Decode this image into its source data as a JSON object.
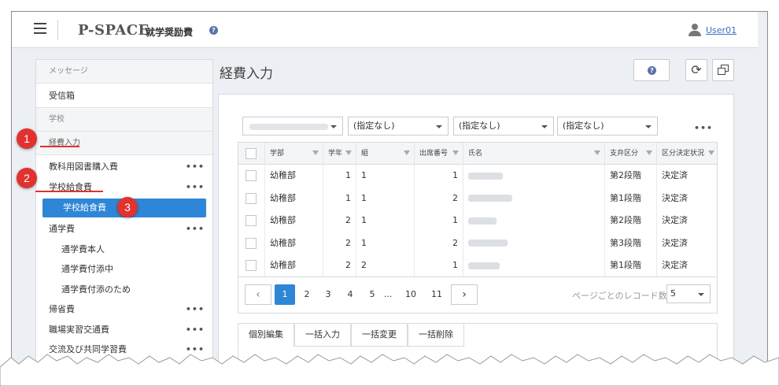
{
  "header": {
    "brand": "P-SPACE",
    "brand_sub": "就学奨励費",
    "user": "User01"
  },
  "sidebar": {
    "sections": [
      {
        "label": "メッセージ"
      },
      {
        "label": "学校"
      }
    ],
    "inbox": "受信箱",
    "expense_input": "経費入力",
    "items": [
      {
        "label": "教科用図書購入費",
        "more": "•••"
      },
      {
        "label": "学校給食費",
        "more": "•••"
      },
      {
        "label": "学校給食費",
        "active": true
      },
      {
        "label": "通学費",
        "more": "•••"
      },
      {
        "label": "通学費本人"
      },
      {
        "label": "通学費付添中"
      },
      {
        "label": "通学費付添のため"
      },
      {
        "label": "帰省費",
        "more": "•••"
      },
      {
        "label": "職場実習交通費",
        "more": "•••"
      },
      {
        "label": "交流及び共同学習費",
        "more": "•••"
      }
    ]
  },
  "callouts": [
    "1",
    "2",
    "3"
  ],
  "main": {
    "title": "経費入力",
    "refresh_glyph": "⟳",
    "filters": [
      "(指定なし)",
      "(指定なし)",
      "(指定なし)"
    ],
    "more": "•••",
    "grid": {
      "columns": [
        "学部",
        "学年",
        "組",
        "出席番号",
        "氏名",
        "支弁区分",
        "区分決定状況"
      ],
      "rows": [
        {
          "dept": "幼稚部",
          "grade": "1",
          "cls": "1",
          "num": "1",
          "tier": "第2段階",
          "status": "決定済"
        },
        {
          "dept": "幼稚部",
          "grade": "1",
          "cls": "1",
          "num": "2",
          "tier": "第1段階",
          "status": "決定済"
        },
        {
          "dept": "幼稚部",
          "grade": "2",
          "cls": "1",
          "num": "1",
          "tier": "第2段階",
          "status": "決定済"
        },
        {
          "dept": "幼稚部",
          "grade": "2",
          "cls": "1",
          "num": "2",
          "tier": "第3段階",
          "status": "決定済"
        },
        {
          "dept": "幼稚部",
          "grade": "2",
          "cls": "2",
          "num": "1",
          "tier": "第1段階",
          "status": "決定済"
        }
      ]
    },
    "pager": {
      "prev": "‹",
      "next": "›",
      "pages": [
        "1",
        "2",
        "3",
        "4",
        "5",
        "...",
        "10",
        "11"
      ],
      "active_page": "1",
      "per_page_label": "ページごとのレコード数",
      "per_page": "5"
    },
    "tabs": [
      "個別編集",
      "一括入力",
      "一括変更",
      "一括削除"
    ]
  },
  "colors": {
    "accent": "#2e86d6",
    "callout": "#e0322f",
    "link": "#3b6fc4"
  }
}
